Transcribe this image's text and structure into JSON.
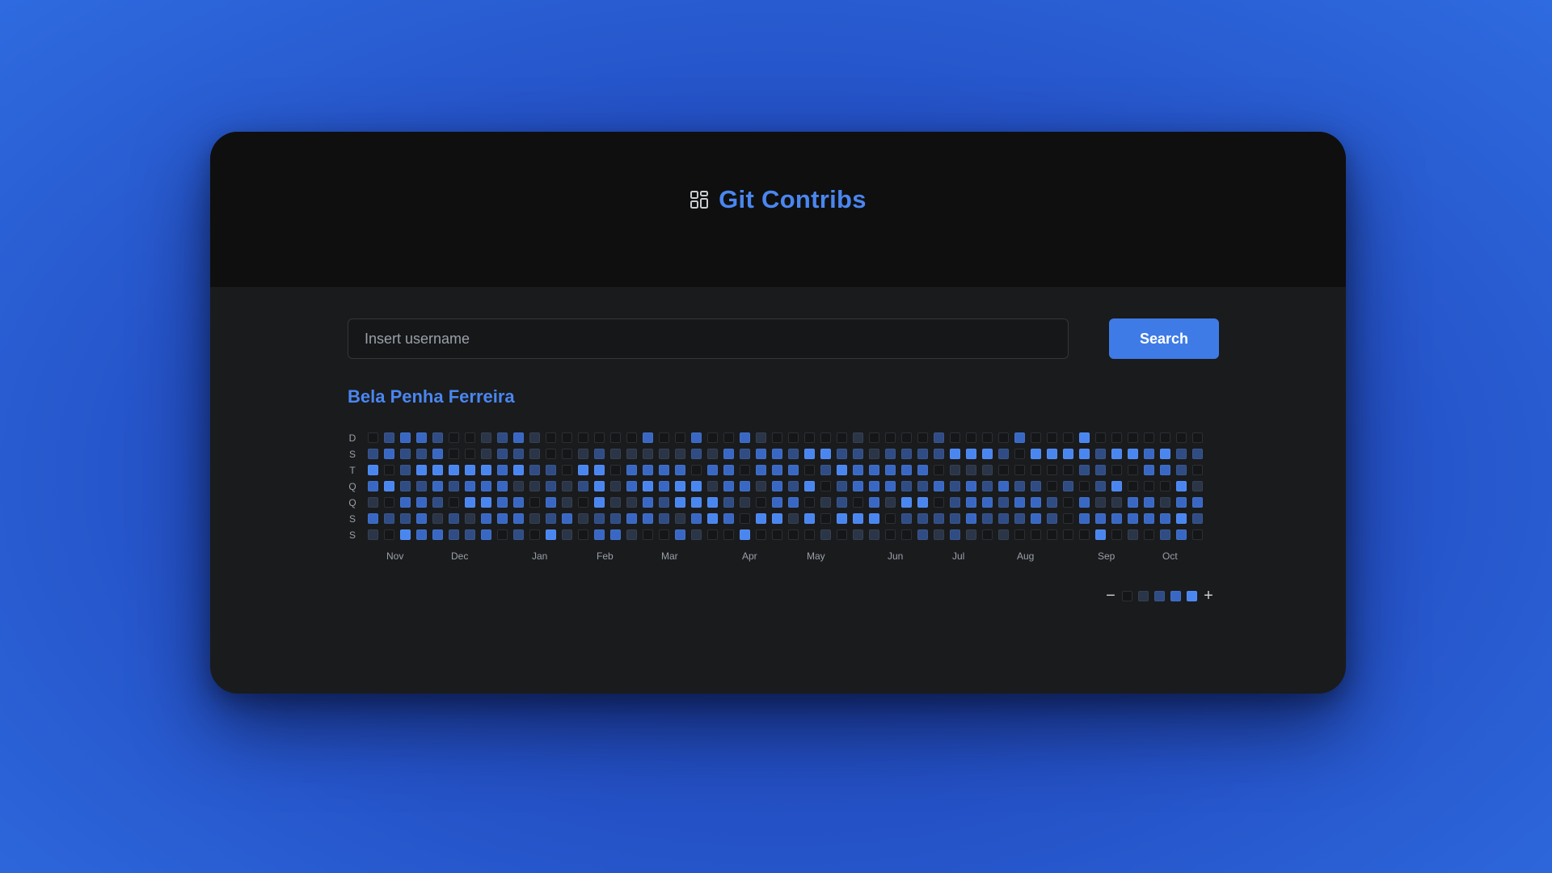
{
  "app": {
    "title": "Git Contribs",
    "icon": "dashboard-grid-icon"
  },
  "search": {
    "placeholder": "Insert username",
    "value": "",
    "button_label": "Search"
  },
  "profile": {
    "name": "Bela Penha Ferreira"
  },
  "colors": {
    "accent": "#3f7be6",
    "title": "#4a86f0",
    "level0_fill": "#151618",
    "level0_border": "#2c2f34",
    "level1": "#2a3548",
    "level2": "#2f4c84",
    "level3": "#3868c4",
    "level4": "#4a86f0"
  },
  "graph": {
    "day_labels": [
      "D",
      "S",
      "T",
      "Q",
      "Q",
      "S",
      "S"
    ],
    "months": [
      {
        "label": "Nov",
        "week": 1
      },
      {
        "label": "Dec",
        "week": 5
      },
      {
        "label": "Jan",
        "week": 10
      },
      {
        "label": "Feb",
        "week": 14
      },
      {
        "label": "Mar",
        "week": 18
      },
      {
        "label": "Apr",
        "week": 23
      },
      {
        "label": "May",
        "week": 27
      },
      {
        "label": "Jun",
        "week": 32
      },
      {
        "label": "Jul",
        "week": 36
      },
      {
        "label": "Aug",
        "week": 40
      },
      {
        "label": "Sep",
        "week": 45
      },
      {
        "label": "Oct",
        "week": 49
      }
    ],
    "levels": [
      "0233200123100000030030031000001000020000300040000000000000000000000000",
      "2322300122100121111121323324422122224442044442443422004002200000000000",
      "4024444434220440333303303330243333301110000022003320020000000000000000",
      "3422323331121241343441331324023332232323220202400041333320020000000000",
      "1033204433031041132444210330120314402332332031133133402202302224000000",
      "3223121333123122332134304414044402222322232033333342200320022302300000",
      "1043322302041033100310040000101100212101000004010230010000100000000000"
    ]
  },
  "legend": {
    "less_label": "−",
    "more_label": "+",
    "levels": [
      0,
      1,
      2,
      3,
      4
    ]
  }
}
